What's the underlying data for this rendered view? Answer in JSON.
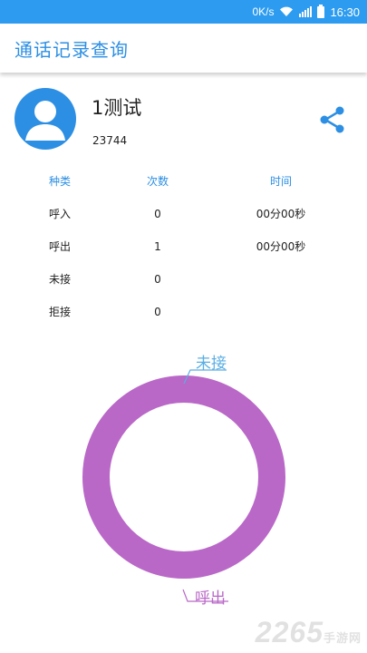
{
  "status_bar": {
    "network_speed": "0K/s",
    "time": "16:30"
  },
  "app_bar": {
    "title": "通话记录查询"
  },
  "contact": {
    "name": "1测试",
    "number": "23744"
  },
  "table": {
    "headers": [
      "种类",
      "次数",
      "时间"
    ],
    "rows": [
      [
        "呼入",
        "0",
        "00分00秒"
      ],
      [
        "呼出",
        "1",
        "00分00秒"
      ],
      [
        "未接",
        "0",
        ""
      ],
      [
        "拒接",
        "0",
        ""
      ]
    ]
  },
  "chart_data": {
    "type": "pie",
    "variant": "donut",
    "slices": [
      {
        "label": "呼入",
        "value": 0
      },
      {
        "label": "呼出",
        "value": 1
      },
      {
        "label": "未接",
        "value": 0
      },
      {
        "label": "拒接",
        "value": 0
      }
    ],
    "annotations": [
      {
        "text": "未接",
        "color": "#5aaee3"
      },
      {
        "text": "呼出",
        "color": "#b968c7"
      }
    ],
    "colors": {
      "呼出": "#b968c7",
      "未接": "#5aaee3"
    }
  },
  "watermark": {
    "main": "2265",
    "sub": "手游网"
  },
  "colors": {
    "status_bar": "#2d9cf0",
    "accent": "#2d8fe3",
    "donut": "#b968c7"
  }
}
